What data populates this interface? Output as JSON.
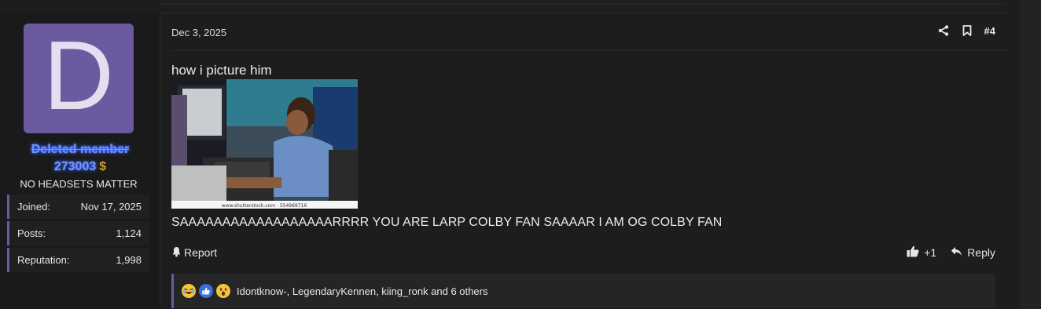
{
  "user": {
    "avatar_letter": "D",
    "name": "Deleted member",
    "id": "273003",
    "title": "NO HEADSETS MATTER",
    "extras": [
      {
        "label": "Joined:",
        "value": "Nov 17, 2025"
      },
      {
        "label": "Posts:",
        "value": "1,124"
      },
      {
        "label": "Reputation:",
        "value": "1,998"
      }
    ],
    "icon": "dollar-icon"
  },
  "post": {
    "date": "Dec 3, 2025",
    "number": "#4",
    "line1": "how i picture him",
    "image_caption": "www.shutterstock.com · 554969716",
    "line2": "SAAAAAAAAAAAAAAAAAARRRR YOU ARE LARP COLBY FAN SAAAAR I AM OG COLBY FAN"
  },
  "actions": {
    "report": "Report",
    "like": "+1",
    "reply": "Reply"
  },
  "reactions": {
    "icons": [
      "laugh-reaction-icon",
      "like-reaction-icon",
      "wow-reaction-icon"
    ],
    "text": "Idontknow-, LegendaryKennen, kiing_ronk and 6 others"
  },
  "colors": {
    "accent": "#6b5aa0",
    "username": "#7396ff",
    "background": "#1d1d1d"
  }
}
